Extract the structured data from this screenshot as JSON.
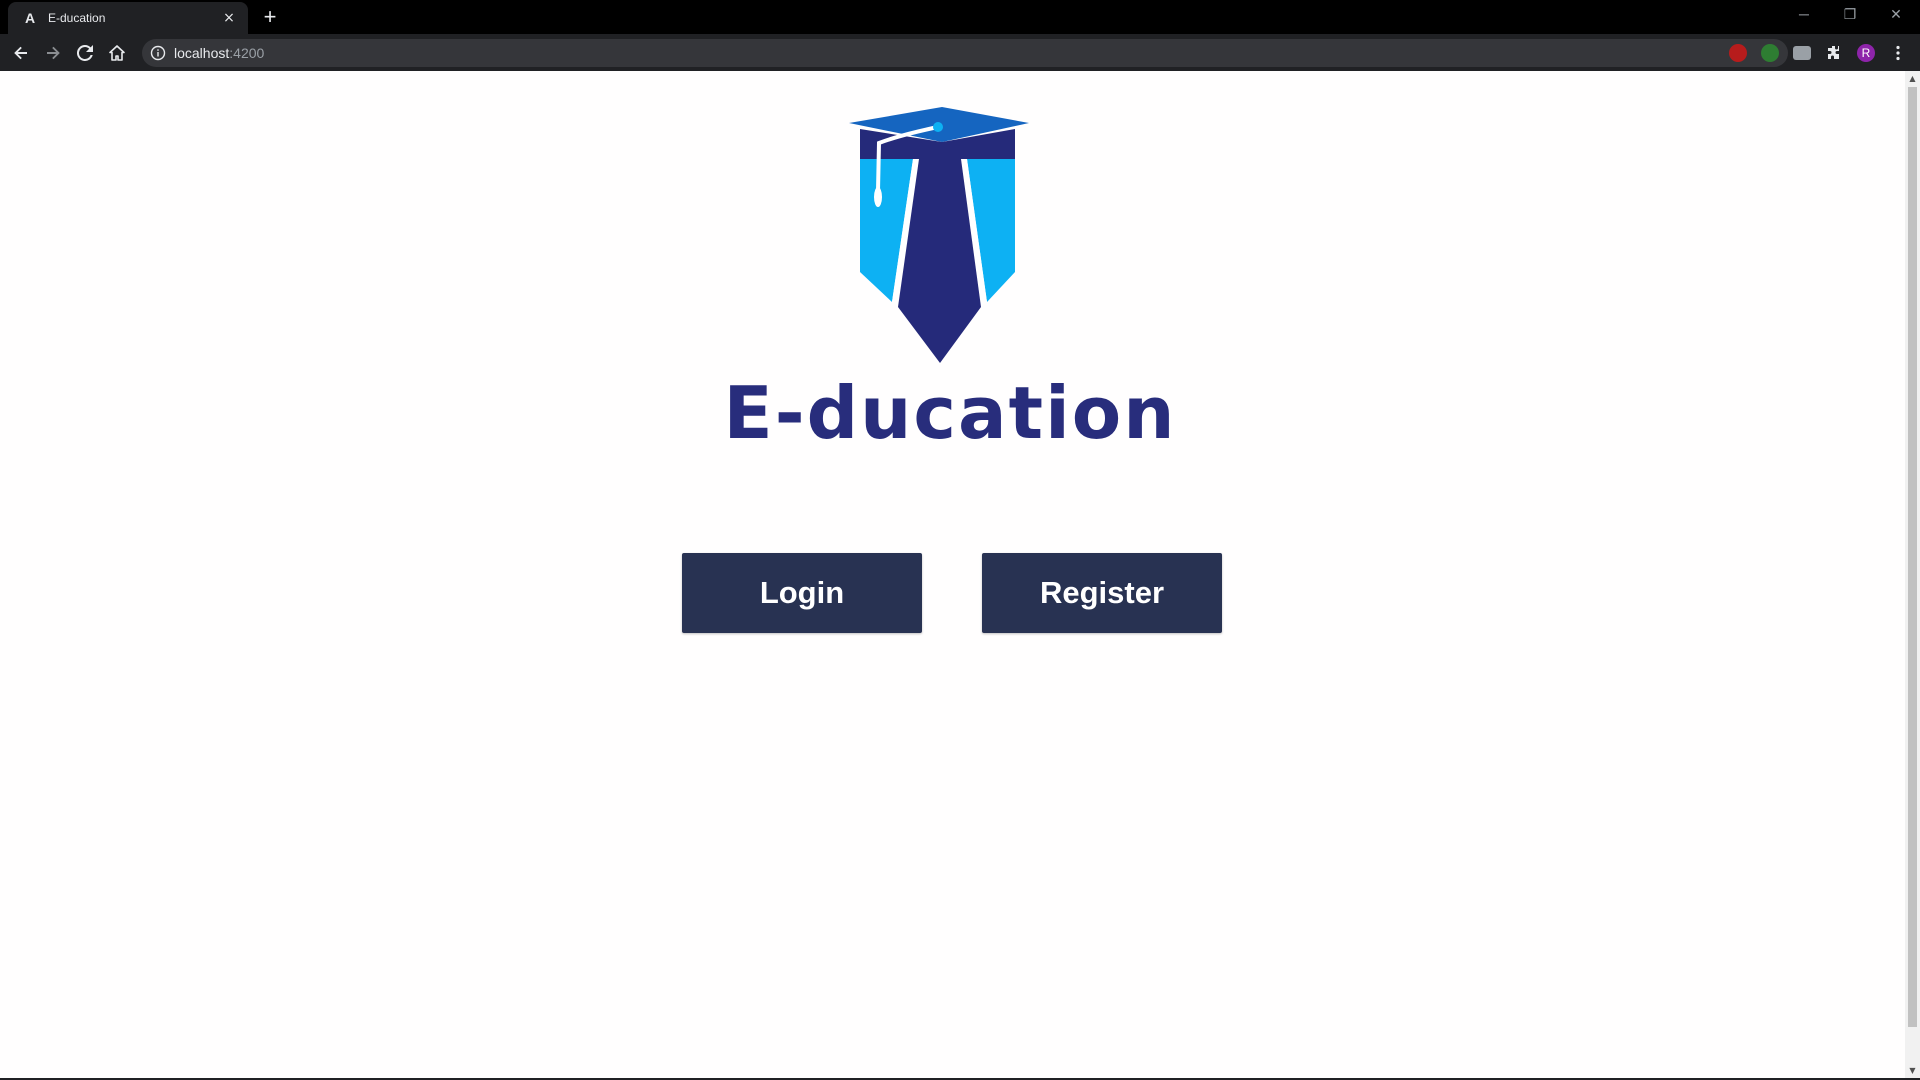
{
  "browser": {
    "tab": {
      "title": "E-ducation",
      "favicon": "A",
      "close_icon": "×"
    },
    "new_tab_icon": "+",
    "window_controls": {
      "minimize": "─",
      "restore": "❐",
      "close": "✕"
    },
    "address": {
      "host": "localhost",
      "port": ":4200"
    },
    "extensions": [
      {
        "name": "ublock-icon",
        "color": "#b71c1c"
      },
      {
        "name": "green-extension-icon",
        "color": "#2e7d32"
      },
      {
        "name": "grey-extension-icon",
        "color": "#9aa0a6"
      },
      {
        "name": "puzzle-icon",
        "color": "#e8eaed"
      },
      {
        "name": "profile-avatar",
        "color": "#8e24aa",
        "letter": "R"
      }
    ]
  },
  "page": {
    "brand_name": "E-ducation",
    "buttons": {
      "login": "Login",
      "register": "Register"
    }
  },
  "colors": {
    "brand_text": "#282d7c",
    "button_bg": "#283252",
    "logo_dark": "#252a7a",
    "logo_light": "#0db1f3",
    "cap": "#1565c0"
  }
}
